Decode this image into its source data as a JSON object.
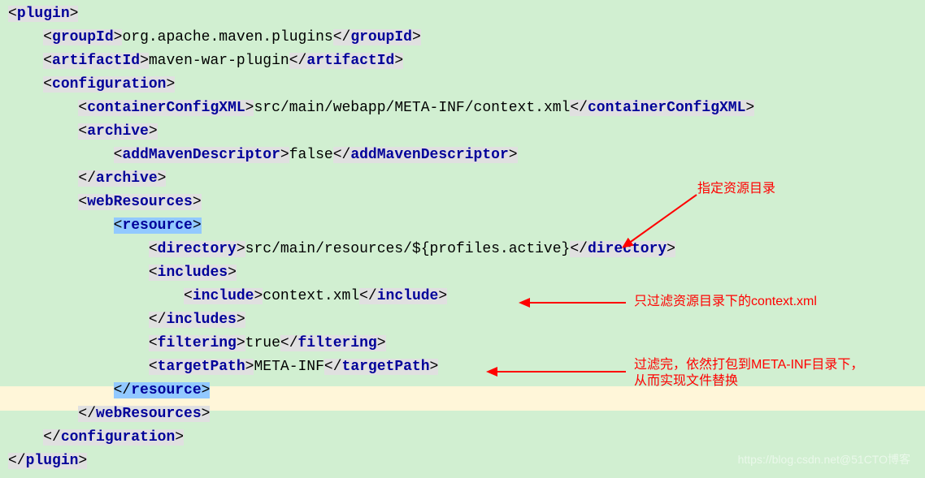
{
  "xml": {
    "plugin_open": "plugin",
    "plugin_close": "plugin",
    "groupId_tag": "groupId",
    "groupId_val": "org.apache.maven.plugins",
    "artifactId_tag": "artifactId",
    "artifactId_val": "maven-war-plugin",
    "configuration_tag": "configuration",
    "containerConfigXML_tag": "containerConfigXML",
    "containerConfigXML_val": "src/main/webapp/META-INF/context.xml",
    "archive_tag": "archive",
    "addMavenDescriptor_tag": "addMavenDescriptor",
    "addMavenDescriptor_val": "false",
    "webResources_tag": "webResources",
    "resource_tag": "resource",
    "directory_tag": "directory",
    "directory_val": "src/main/resources/${profiles.active}",
    "includes_tag": "includes",
    "include_tag": "include",
    "include_val": "context.xml",
    "filtering_tag": "filtering",
    "filtering_val": "true",
    "targetPath_tag": "targetPath",
    "targetPath_val": "META-INF"
  },
  "annotations": {
    "a1": "指定资源目录",
    "a2": "只过滤资源目录下的context.xml",
    "a3_line1": "过滤完，依然打包到META-INF目录下，",
    "a3_line2": "从而实现文件替换"
  },
  "watermark": "https://blog.csdn.net@51CTO博客"
}
